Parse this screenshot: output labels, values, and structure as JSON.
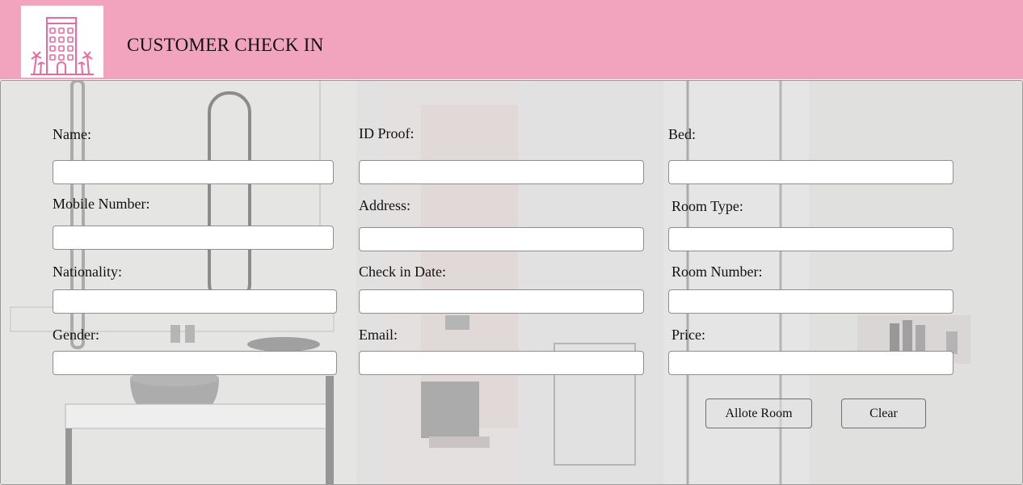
{
  "header": {
    "title": "CUSTOMER CHECK IN",
    "logo_icon": "hotel-building-icon"
  },
  "colors": {
    "header_bg": "#f2a4bf",
    "logo_accent": "#e86a9e"
  },
  "form": {
    "name": {
      "label": "Name:",
      "value": ""
    },
    "id_proof": {
      "label": "ID Proof:",
      "value": ""
    },
    "bed": {
      "label": "Bed:",
      "value": ""
    },
    "mobile": {
      "label": "Mobile Number:",
      "value": ""
    },
    "address": {
      "label": "Address:",
      "value": ""
    },
    "room_type": {
      "label": "Room Type:",
      "value": ""
    },
    "nationality": {
      "label": "Nationality:",
      "value": ""
    },
    "check_in_date": {
      "label": "Check in Date:",
      "value": ""
    },
    "room_number": {
      "label": "Room Number:",
      "value": ""
    },
    "gender": {
      "label": "Gender:",
      "value": ""
    },
    "email": {
      "label": "Email:",
      "value": ""
    },
    "price": {
      "label": "Price:",
      "value": ""
    }
  },
  "actions": {
    "allot_label": "Allote Room",
    "clear_label": "Clear"
  }
}
